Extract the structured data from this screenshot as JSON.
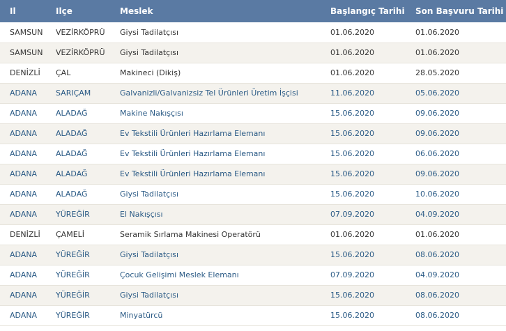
{
  "table": {
    "headers": {
      "il": "Il",
      "ilce": "Ilçe",
      "meslek": "Meslek",
      "baslangic": "Başlangıç Tarihi",
      "son_basvuru": "Son Başvuru Tarihi"
    },
    "rows": [
      {
        "il": "SAMSUN",
        "ilce": "VEZİRKÖPRÜ",
        "meslek": "Giysi Tadilatçısı",
        "baslangic": "01.06.2020",
        "son_basvuru": "01.06.2020"
      },
      {
        "il": "SAMSUN",
        "ilce": "VEZİRKÖPRÜ",
        "meslek": "Giysi Tadilatçısı",
        "baslangic": "01.06.2020",
        "son_basvuru": "01.06.2020"
      },
      {
        "il": "DENİZLİ",
        "ilce": "ÇAL",
        "meslek": "Makineci (Dikiş)",
        "baslangic": "01.06.2020",
        "son_basvuru": "28.05.2020"
      },
      {
        "il": "ADANA",
        "ilce": "SARIÇAM",
        "meslek": "Galvanizli/Galvanizsiz Tel Ürünleri Üretim İşçisi",
        "baslangic": "11.06.2020",
        "son_basvuru": "05.06.2020"
      },
      {
        "il": "ADANA",
        "ilce": "ALADAĞ",
        "meslek": "Makine Nakışçısı",
        "baslangic": "15.06.2020",
        "son_basvuru": "09.06.2020"
      },
      {
        "il": "ADANA",
        "ilce": "ALADAĞ",
        "meslek": "Ev Tekstili Ürünleri Hazırlama Elemanı",
        "baslangic": "15.06.2020",
        "son_basvuru": "09.06.2020"
      },
      {
        "il": "ADANA",
        "ilce": "ALADAĞ",
        "meslek": "Ev Tekstili Ürünleri Hazırlama Elemanı",
        "baslangic": "15.06.2020",
        "son_basvuru": "06.06.2020"
      },
      {
        "il": "ADANA",
        "ilce": "ALADAĞ",
        "meslek": "Ev Tekstili Ürünleri Hazırlama Elemanı",
        "baslangic": "15.06.2020",
        "son_basvuru": "09.06.2020"
      },
      {
        "il": "ADANA",
        "ilce": "ALADAĞ",
        "meslek": "Giysi Tadilatçısı",
        "baslangic": "15.06.2020",
        "son_basvuru": "10.06.2020"
      },
      {
        "il": "ADANA",
        "ilce": "YÜREĞİR",
        "meslek": "El Nakışçısı",
        "baslangic": "07.09.2020",
        "son_basvuru": "04.09.2020"
      },
      {
        "il": "DENİZLİ",
        "ilce": "ÇAMELİ",
        "meslek": "Seramik Sırlama Makinesi Operatörü",
        "baslangic": "01.06.2020",
        "son_basvuru": "01.06.2020"
      },
      {
        "il": "ADANA",
        "ilce": "YÜREĞİR",
        "meslek": "Giysi Tadilatçısı",
        "baslangic": "15.06.2020",
        "son_basvuru": "08.06.2020"
      },
      {
        "il": "ADANA",
        "ilce": "YÜREĞİR",
        "meslek": "Çocuk Gelişimi Meslek Elemanı",
        "baslangic": "07.09.2020",
        "son_basvuru": "04.09.2020"
      },
      {
        "il": "ADANA",
        "ilce": "YÜREĞİR",
        "meslek": "Giysi Tadilatçısı",
        "baslangic": "15.06.2020",
        "son_basvuru": "08.06.2020"
      },
      {
        "il": "ADANA",
        "ilce": "YÜREĞİR",
        "meslek": "Minyatürcü",
        "baslangic": "15.06.2020",
        "son_basvuru": "08.06.2020"
      }
    ]
  },
  "colors": {
    "header_bg": "#5a7aa3",
    "header_text": "#ffffff",
    "row_stripe": "#f4f2ed",
    "link_text": "#2a5a85",
    "plain_text": "#333333"
  }
}
